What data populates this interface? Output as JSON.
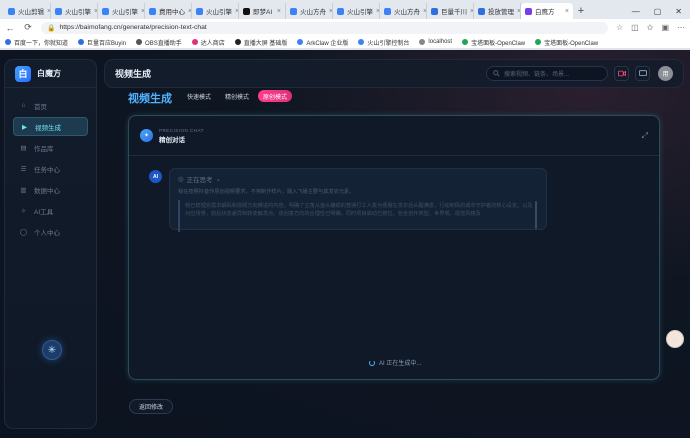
{
  "browser": {
    "tabs": [
      {
        "label": "火山剪辑",
        "color": "#3b82f6"
      },
      {
        "label": "火山引擎",
        "color": "#3b82f6"
      },
      {
        "label": "火山引擎",
        "color": "#3b82f6"
      },
      {
        "label": "费用中心",
        "color": "#3b82f6"
      },
      {
        "label": "火山引擎",
        "color": "#3b82f6"
      },
      {
        "label": "即梦AI",
        "color": "#111111"
      },
      {
        "label": "火山方舟",
        "color": "#3b82f6"
      },
      {
        "label": "火山引擎",
        "color": "#3b82f6"
      },
      {
        "label": "火山方舟",
        "color": "#3b82f6"
      },
      {
        "label": "巨量千川",
        "color": "#2f6fe0"
      },
      {
        "label": "投放管理",
        "color": "#2f6fe0"
      },
      {
        "label": "白鹰方",
        "color": "#7c3aed",
        "active": true
      }
    ],
    "new_tab": "+",
    "window_controls": [
      "—",
      "▢",
      "✕"
    ],
    "url": "https://baimofang.cn/generate/precision-text-chat",
    "bookmarks": [
      {
        "label": "百度一下，你就知道",
        "color": "#2f6fe0"
      },
      {
        "label": "巨量百应Buyin",
        "color": "#2f6fe0"
      },
      {
        "label": "OBS直播助手",
        "color": "#555555"
      },
      {
        "label": "达人商店",
        "color": "#e0307a"
      },
      {
        "label": "直播大屏 基础版",
        "color": "#222222"
      },
      {
        "label": "ArkClaw 企业版",
        "color": "#3b82f6"
      },
      {
        "label": "火山引擎控制台",
        "color": "#3b82f6"
      },
      {
        "label": "localhost",
        "color": "#888888"
      },
      {
        "label": "宝塔面板-OpenClaw",
        "color": "#22a355"
      },
      {
        "label": "宝塔面板-OpenClaw",
        "color": "#22a355"
      }
    ]
  },
  "sidebar": {
    "brand_logo": "白",
    "brand_name": "白魔方",
    "items": [
      {
        "label": "首页",
        "icon": "home-icon"
      },
      {
        "label": "视频生成",
        "icon": "video-icon",
        "active": true
      },
      {
        "label": "作品库",
        "icon": "folder-icon"
      },
      {
        "label": "任务中心",
        "icon": "task-icon"
      },
      {
        "label": "数据中心",
        "icon": "chart-icon"
      },
      {
        "label": "AI工具",
        "icon": "tool-icon"
      },
      {
        "label": "个人中心",
        "icon": "user-icon"
      }
    ]
  },
  "header": {
    "title": "视频生成",
    "search_placeholder": "搜索视频、链条、场景...",
    "avatar_text": "用"
  },
  "main": {
    "page_title": "视频生成",
    "modes": [
      {
        "label": "快速模式"
      },
      {
        "label": "精创模式"
      },
      {
        "label": "原创模式",
        "active": true
      }
    ],
    "chat": {
      "subtitle": "PRECISION CHAT",
      "title": "精创对话",
      "ai_badge": "AI",
      "thinking_label": "正在思考",
      "thinking_summary": "我在按照抖音作原创视频要求，不用制作样片，融入飞播主要与其发衣元素。",
      "thinking_detail": "我已梳理完需求解码和视频方向推进的内容。明确了主角从渔头编缆的普通打工人变为便服在发衣后头醒满意，行动和情的城市守护者的核心设定。以及对应场景，前后状态差异和转变触发点。该创意方向的合理性已明确，同时项目启动已按位，包含创作类型、世界观、视觉风格及",
      "generating_text": "AI 正在生成中..."
    },
    "back_button": "返回修改"
  }
}
